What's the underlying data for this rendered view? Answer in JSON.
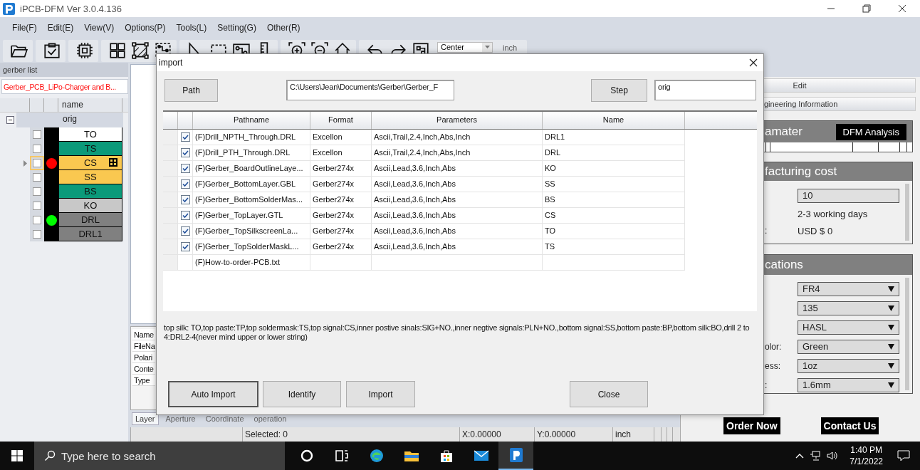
{
  "window": {
    "title": "iPCB-DFM Ver 3.0.4.136"
  },
  "menu": [
    "File(F)",
    "Edit(E)",
    "View(V)",
    "Options(P)",
    "Tools(L)",
    "Setting(G)",
    "Other(R)"
  ],
  "toolbar": {
    "align_dropdown": "Center",
    "unit": "inch"
  },
  "gerber_list": {
    "title": "gerber list",
    "job_tab": "Gerber_PCB_LiPo-Charger and B...",
    "column": "name",
    "step": {
      "name": "orig",
      "expanded": true
    },
    "layers": [
      {
        "name": "TO",
        "color": "#ffffff",
        "checked": false,
        "current": false
      },
      {
        "name": "TS",
        "color": "#0b9a7a",
        "checked": false,
        "current": false
      },
      {
        "name": "CS",
        "color": "#fac850",
        "checked": false,
        "current": true,
        "marker": {
          "color": "#ff0000"
        }
      },
      {
        "name": "SS",
        "color": "#fac850",
        "checked": false,
        "current": false
      },
      {
        "name": "BS",
        "color": "#0b9a7a",
        "checked": false,
        "current": false
      },
      {
        "name": "KO",
        "color": "#c8c8c8",
        "checked": false,
        "current": false
      },
      {
        "name": "DRL",
        "color": "#808080",
        "checked": false,
        "current": false,
        "marker": {
          "color": "#00ff00"
        }
      },
      {
        "name": "DRL1",
        "color": "#808080",
        "checked": false,
        "current": false
      }
    ]
  },
  "info_panel": {
    "fields": [
      "Name",
      "FileNa",
      "Polari",
      "Conte",
      "Type"
    ]
  },
  "bottom_tabs": [
    {
      "label": "Layer",
      "selected": true
    },
    {
      "label": "Aperture",
      "selected": false
    },
    {
      "label": "Coordinate",
      "selected": false
    },
    {
      "label": "operation",
      "selected": false
    }
  ],
  "status_bar": {
    "selected": "Selected: 0",
    "x": "X:0.00000",
    "y": "Y:0.00000",
    "unit": "inch"
  },
  "right_panel": {
    "edit_bar": "Edit",
    "info_bar": "gineering Information",
    "parameter": {
      "title": "amater",
      "button": "DFM Analysis"
    },
    "cost": {
      "title": "facturing cost",
      "rows": [
        {
          "kind": "field",
          "value": "10"
        },
        {
          "kind": "text",
          "value": "2-3 working days"
        },
        {
          "kind": "text",
          "label": ":",
          "value": "USD $ 0"
        }
      ]
    },
    "specs": {
      "title": "cations",
      "rows": [
        {
          "value": "FR4"
        },
        {
          "value": "135"
        },
        {
          "value": "HASL"
        },
        {
          "label": "olor:",
          "value": "Green"
        },
        {
          "label": "ess:",
          "value": "1oz"
        },
        {
          "label": ":",
          "value": "1.6mm"
        }
      ]
    },
    "buttons": [
      "Order Now",
      "Contact Us"
    ]
  },
  "dialog": {
    "title": "import",
    "path_button": "Path",
    "path": "C:\\Users\\Jean\\Documents\\Gerber\\Gerber_F",
    "step_button": "Step",
    "step": "orig",
    "columns": [
      "Pathname",
      "Format",
      "Parameters",
      "Name"
    ],
    "rows": [
      {
        "kind": "layer",
        "checked": true,
        "pathname": "(F)Drill_NPTH_Through.DRL",
        "format": "Excellon",
        "parameters": "Ascii,Trail,2.4,Inch,Abs,Inch",
        "name": "DRL1"
      },
      {
        "kind": "layer",
        "checked": true,
        "pathname": "(F)Drill_PTH_Through.DRL",
        "format": "Excellon",
        "parameters": "Ascii,Trail,2.4,Inch,Abs,Inch",
        "name": "DRL"
      },
      {
        "kind": "layer",
        "checked": true,
        "pathname": "(F)Gerber_BoardOutlineLaye...",
        "format": "Gerber274x",
        "parameters": "Ascii,Lead,3.6,Inch,Abs",
        "name": "KO"
      },
      {
        "kind": "layer",
        "checked": true,
        "pathname": "(F)Gerber_BottomLayer.GBL",
        "format": "Gerber274x",
        "parameters": "Ascii,Lead,3.6,Inch,Abs",
        "name": "SS"
      },
      {
        "kind": "layer",
        "checked": true,
        "pathname": "(F)Gerber_BottomSolderMas...",
        "format": "Gerber274x",
        "parameters": "Ascii,Lead,3.6,Inch,Abs",
        "name": "BS"
      },
      {
        "kind": "layer",
        "checked": true,
        "pathname": "(F)Gerber_TopLayer.GTL",
        "format": "Gerber274x",
        "parameters": "Ascii,Lead,3.6,Inch,Abs",
        "name": "CS"
      },
      {
        "kind": "layer",
        "checked": true,
        "pathname": "(F)Gerber_TopSilkscreenLa...",
        "format": "Gerber274x",
        "parameters": "Ascii,Lead,3.6,Inch,Abs",
        "name": "TO"
      },
      {
        "kind": "layer",
        "checked": true,
        "pathname": "(F)Gerber_TopSolderMaskL...",
        "format": "Gerber274x",
        "parameters": "Ascii,Lead,3.6,Inch,Abs",
        "name": "TS"
      },
      {
        "kind": "plain",
        "pathname": "(F)How-to-order-PCB.txt"
      }
    ],
    "hint": "top silk: TO,top paste:TP,top soldermask:TS,top signal:CS,inner postive sinals:SIG+NO.,inner negtive signals:PLN+NO.,bottom signal:SS,bottom paste:BP,bottom silk:BO,drill 2 to 4:DRL2-4(never mind upper or lower string)",
    "buttons": [
      {
        "label": "Auto Import",
        "default": true
      },
      {
        "label": "Identify",
        "default": false
      },
      {
        "label": "Import",
        "default": false
      },
      {
        "label": "Close",
        "default": false
      }
    ]
  },
  "taskbar": {
    "search_placeholder": "Type here to search",
    "apps": [
      {
        "selected": false
      },
      {
        "selected": false
      },
      {
        "selected": false
      },
      {
        "selected": false
      },
      {
        "selected": false
      },
      {
        "selected": false
      },
      {
        "selected": true
      }
    ],
    "time": "1:40 PM",
    "date": "7/1/2022"
  }
}
